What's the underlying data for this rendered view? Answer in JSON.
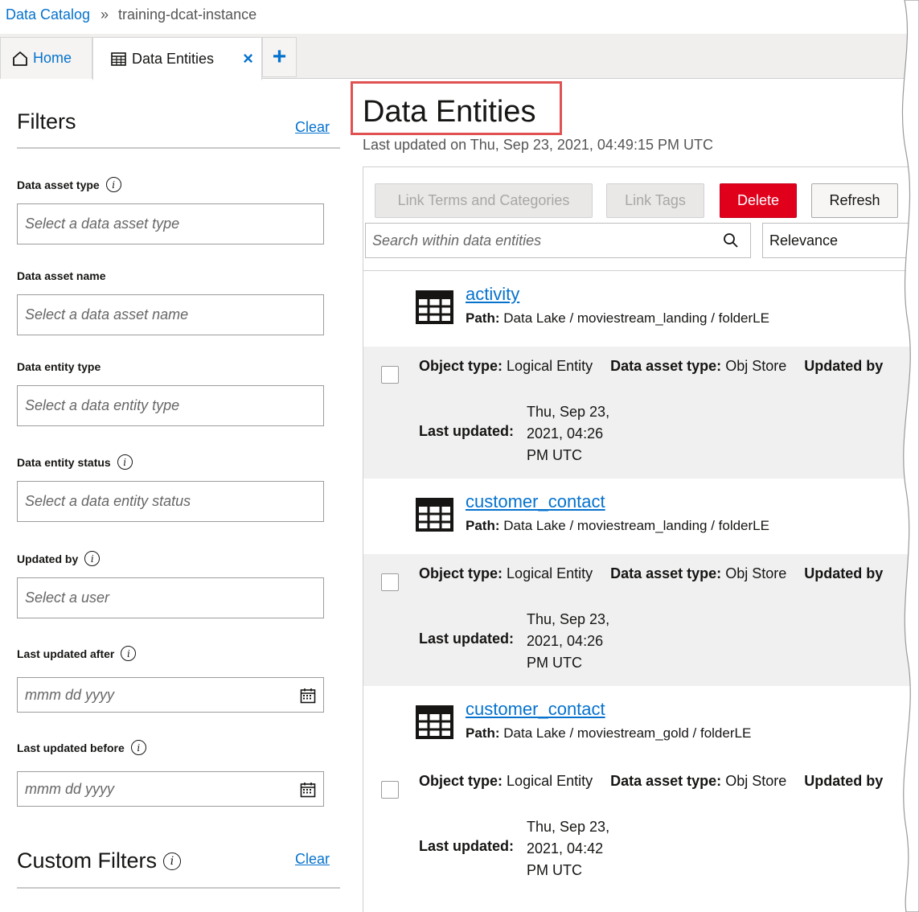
{
  "breadcrumb": {
    "root": "Data Catalog",
    "separator": "»",
    "current": "training-dcat-instance"
  },
  "tabs": {
    "home_label": "Home",
    "active_label": "Data Entities",
    "close_glyph": "×",
    "add_glyph": "+"
  },
  "filters": {
    "title": "Filters",
    "clear_label": "Clear",
    "fields": [
      {
        "label": "Data asset type",
        "placeholder": "Select a data asset type",
        "info": true
      },
      {
        "label": "Data asset name",
        "placeholder": "Select a data asset name",
        "info": false
      },
      {
        "label": "Data entity type",
        "placeholder": "Select a data entity type",
        "info": false
      },
      {
        "label": "Data entity status",
        "placeholder": "Select a data entity status",
        "info": true
      },
      {
        "label": "Updated by",
        "placeholder": "Select a user",
        "info": true
      },
      {
        "label": "Last updated after",
        "placeholder": "mmm dd yyyy",
        "info": true
      },
      {
        "label": "Last updated before",
        "placeholder": "mmm dd yyyy",
        "info": true
      }
    ],
    "custom_title": "Custom Filters",
    "custom_clear_label": "Clear"
  },
  "main": {
    "title": "Data Entities",
    "last_updated": "Last updated on Thu, Sep 23, 2021, 04:49:15 PM UTC",
    "toolbar": {
      "link_terms": "Link Terms and Categories",
      "link_tags": "Link Tags",
      "delete": "Delete",
      "refresh": "Refresh"
    },
    "search_placeholder": "Search within data entities",
    "sort_value": "Relevance",
    "labels": {
      "path": "Path:",
      "object_type": "Object type:",
      "data_asset_type": "Data asset type:",
      "updated_by": "Updated by",
      "last_updated": "Last updated:"
    },
    "items": [
      {
        "name": "activity",
        "path": "Data Lake / moviestream_landing / folderLE",
        "object_type": "Logical Entity",
        "data_asset_type": "Obj Store",
        "last_updated_lines": [
          "Thu, Sep 23,",
          "2021, 04:26",
          "PM UTC"
        ]
      },
      {
        "name": "customer_contact",
        "path": "Data Lake / moviestream_landing / folderLE",
        "object_type": "Logical Entity",
        "data_asset_type": "Obj Store",
        "last_updated_lines": [
          "Thu, Sep 23,",
          "2021, 04:26",
          "PM UTC"
        ]
      },
      {
        "name": "customer_contact",
        "path": "Data Lake / moviestream_gold / folderLE",
        "object_type": "Logical Entity",
        "data_asset_type": "Obj Store",
        "last_updated_lines": [
          "Thu, Sep 23,",
          "2021, 04:42",
          "PM UTC"
        ]
      }
    ]
  },
  "colors": {
    "link": "#0572ce",
    "delete": "#e0001c",
    "highlight": "#e05252"
  },
  "icons": [
    "home-icon",
    "table-icon",
    "close-icon",
    "add-icon",
    "info-icon",
    "calendar-icon",
    "search-icon"
  ]
}
